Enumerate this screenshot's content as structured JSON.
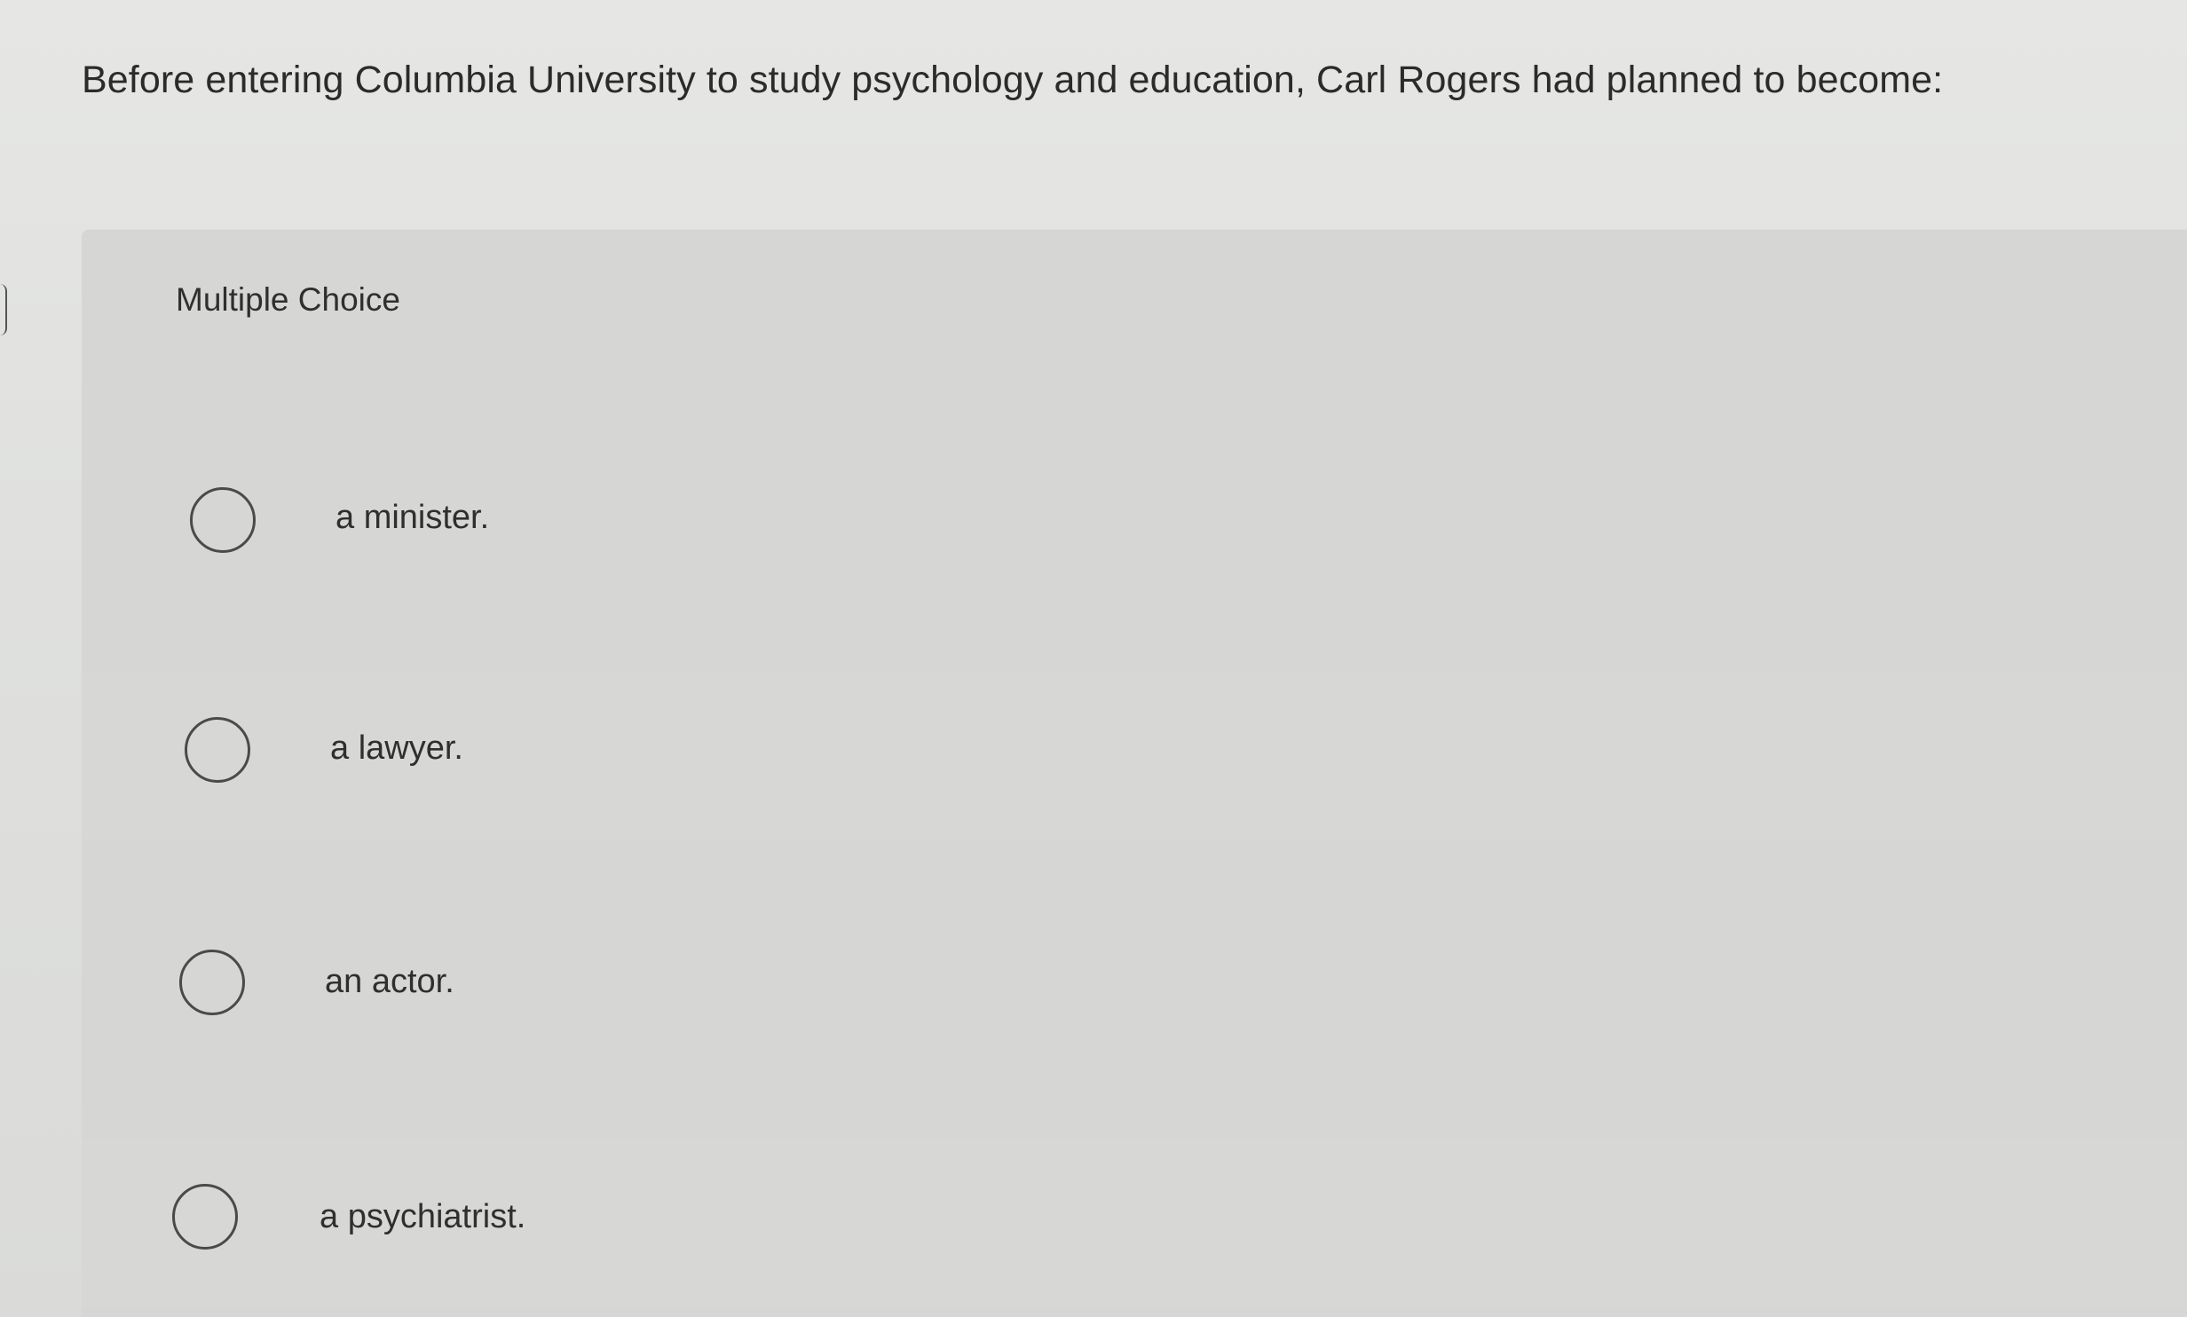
{
  "question": {
    "text": "Before entering Columbia University to study psychology and education, Carl Rogers had planned to become:"
  },
  "panel": {
    "title": "Multiple Choice"
  },
  "choices": [
    {
      "label": "a minister."
    },
    {
      "label": "a lawyer."
    },
    {
      "label": "an actor."
    },
    {
      "label": "a psychiatrist."
    }
  ],
  "colors": {
    "background": "#e2e3e1",
    "panel": "#d6d7d5",
    "text": "#2d2d2d",
    "radio_border": "#4a4a4a"
  }
}
